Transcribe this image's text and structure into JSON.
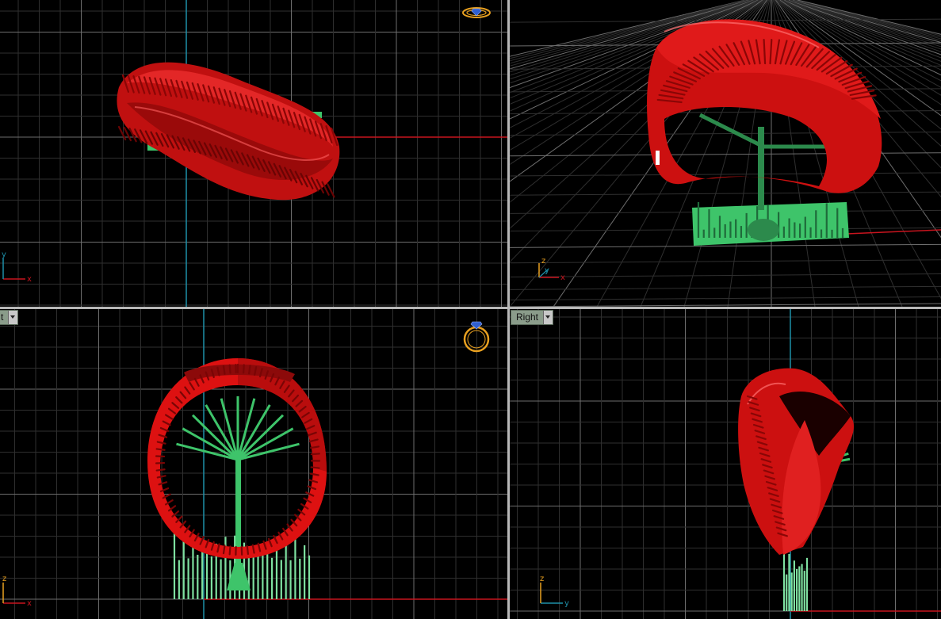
{
  "viewports": {
    "top": {
      "axis_labels": {
        "v": "y",
        "h": "x"
      }
    },
    "perspective": {
      "axis_labels": {
        "v": "z",
        "small": "y",
        "h": "x"
      }
    },
    "front": {
      "tab_label": "t",
      "axis_labels": {
        "v": "z",
        "h": "x"
      }
    },
    "right": {
      "tab_label": "Right",
      "axis_labels": {
        "v": "z",
        "h": "y"
      }
    }
  },
  "icons": {
    "gumball": "ring-gem-icon"
  },
  "colors": {
    "background": "#000000",
    "grid_minor": "#2f2f2f",
    "grid_major": "#6e6e6e",
    "axis_x": "#c8141e",
    "axis_y": "#1e8fa8",
    "model": "#e01414",
    "supports": "#3ec46a",
    "ring_icon": "#e8a020"
  }
}
